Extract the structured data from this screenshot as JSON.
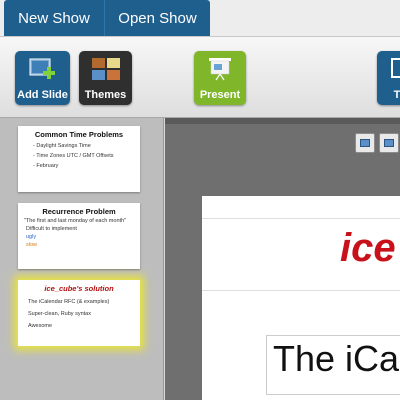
{
  "tabs": [
    {
      "label": "New Show"
    },
    {
      "label": "Open Show"
    }
  ],
  "toolbar": {
    "add_slide_label": "Add Slide",
    "themes_label": "Themes",
    "present_label": "Present",
    "fourth_label": "T"
  },
  "colors": {
    "tab_blue": "#1f5f8e",
    "themes_dark": "#2f2f2f",
    "present_green": "#7fb62a",
    "highlight_yellow": "#e9e43a",
    "title_red": "#c8111b"
  },
  "slides": [
    {
      "title": "Common Time Problems",
      "lines": [
        "- Daylight Savings Time",
        "- Time Zones UTC / GMT Offsets",
        "- February"
      ]
    },
    {
      "title": "Recurrence Problem",
      "lines": [
        "\"The first and last monday of each month\"",
        "Difficult to implement",
        "ugly",
        "slow"
      ]
    },
    {
      "title": "ice_cube's solution",
      "lines": [
        "The iCalendar RFC (& examples)",
        "Super-clean, Ruby syntax",
        "Awesome"
      ]
    }
  ],
  "current_slide": {
    "title": "ice",
    "body": "The iCal"
  }
}
